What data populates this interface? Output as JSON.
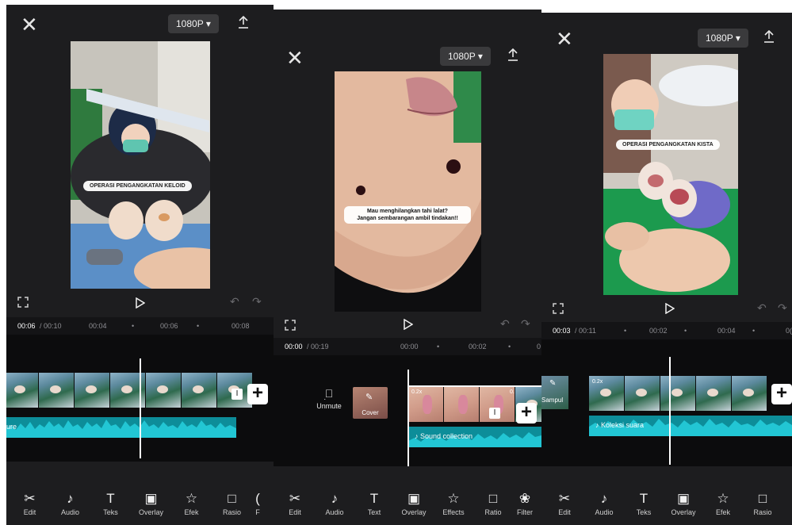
{
  "panel1": {
    "resolution": "1080P ▾",
    "banner": "OPERASI PENGANGKATAN KELOID",
    "time_current": "00:06",
    "time_total": "/ 00:10",
    "ticks": [
      "00:04",
      "•",
      "00:06",
      "•",
      "00:08"
    ],
    "audio_label": "ure",
    "toolbar": [
      "Edit",
      "Audio",
      "Teks",
      "Overlay",
      "Efek",
      "Rasio",
      "F"
    ]
  },
  "panel2": {
    "resolution": "1080P ▾",
    "caption_line1": "Mau menghilangkan tahi lalat?",
    "caption_line2": "Jangan sembarangan ambil tindakan!!",
    "time_current": "00:00",
    "time_total": "/ 00:19",
    "ticks": [
      "00:00",
      "•",
      "00:02",
      "•",
      "0"
    ],
    "unmute_label": "Unmute",
    "cover_label": "Cover",
    "speed1": "0.2x",
    "speed2": "0.",
    "sampul_label": "Sampul",
    "audio_label": "Sound collection",
    "toolbar": [
      "Edit",
      "Audio",
      "Text",
      "Overlay",
      "Effects",
      "Ratio",
      "Filter"
    ]
  },
  "panel3": {
    "resolution": "1080P ▾",
    "banner": "OPERASI PENGANGKATAN KISTA",
    "time_current": "00:03",
    "time_total": "/ 00:11",
    "ticks": [
      "•",
      "00:02",
      "•",
      "00:04",
      "•",
      "0("
    ],
    "speed1": "0.2x",
    "audio_label": "Koleksi suara",
    "toolbar": [
      "Edit",
      "Audio",
      "Teks",
      "Overlay",
      "Efek",
      "Rasio"
    ]
  },
  "icons": {
    "close": "close-icon",
    "export": "export-icon",
    "fullscreen": "fullscreen-icon",
    "play": "play-icon",
    "undo": "undo-icon",
    "redo": "redo-icon",
    "add": "add-clip-icon"
  },
  "colors": {
    "background": "#1d1d1f",
    "audio_wave": "#19b3c1",
    "accent_white": "#ffffff"
  }
}
